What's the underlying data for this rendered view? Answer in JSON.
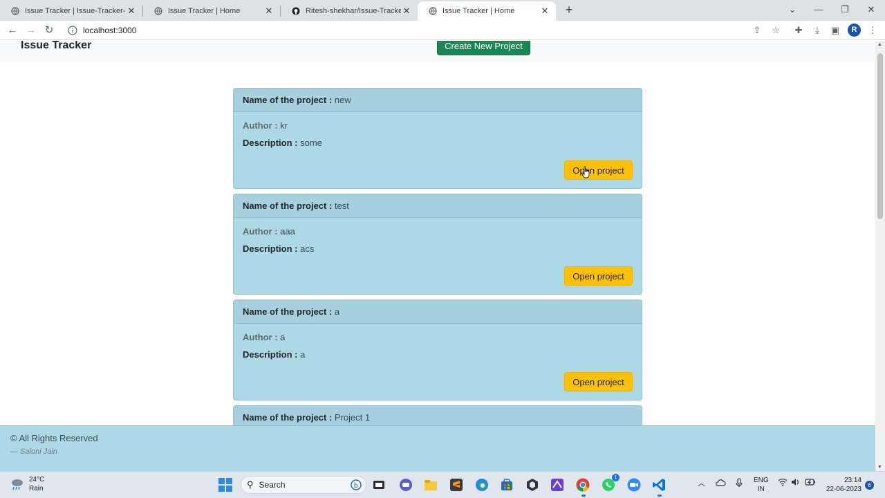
{
  "browser": {
    "tabs": [
      {
        "title": "Issue Tracker | Issue-Tracker-mai"
      },
      {
        "title": "Issue Tracker | Home"
      },
      {
        "title": "Ritesh-shekhar/Issue-Tracker-ma"
      },
      {
        "title": "Issue Tracker | Home"
      }
    ],
    "url": "localhost:3000",
    "profile_initial": "R"
  },
  "app": {
    "brand": "Issue Tracker",
    "create_button": "Create New Project",
    "labels": {
      "name": "Name of the project :",
      "author": "Author :",
      "description": "Description :",
      "open": "Open project"
    },
    "projects": [
      {
        "name": "new",
        "author": "kr",
        "description": "some"
      },
      {
        "name": "test",
        "author": "aaa",
        "description": "acs"
      },
      {
        "name": "a",
        "author": "a",
        "description": "a"
      },
      {
        "name": "Project 1"
      }
    ],
    "footer": {
      "copyright": "© All Rights Reserved",
      "signature": "— Saloni Jain"
    }
  },
  "taskbar": {
    "weather": {
      "temp": "24°C",
      "condition": "Rain"
    },
    "search_placeholder": "Search",
    "whatsapp_badge": "1",
    "lang": {
      "line1": "ENG",
      "line2": "IN"
    },
    "time": "23:14",
    "date": "22-06-2023",
    "notifications": "6"
  },
  "colors": {
    "card_bg": "#add8e6",
    "create_btn": "#198754",
    "open_btn": "#ffc107"
  }
}
